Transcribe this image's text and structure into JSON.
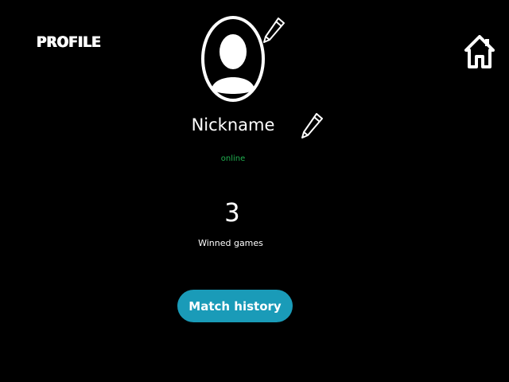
{
  "header": {
    "title": "PROFILE",
    "home_icon": "home-icon"
  },
  "profile": {
    "avatar_icon": "user-avatar-icon",
    "edit_icon": "pencil-icon",
    "nickname": "Nickname",
    "status": "online",
    "status_color": "#20b050"
  },
  "stats": {
    "wins_count": "3",
    "wins_label": "Winned games"
  },
  "actions": {
    "match_history_label": "Match history",
    "match_history_color": "#1a9bb8"
  }
}
